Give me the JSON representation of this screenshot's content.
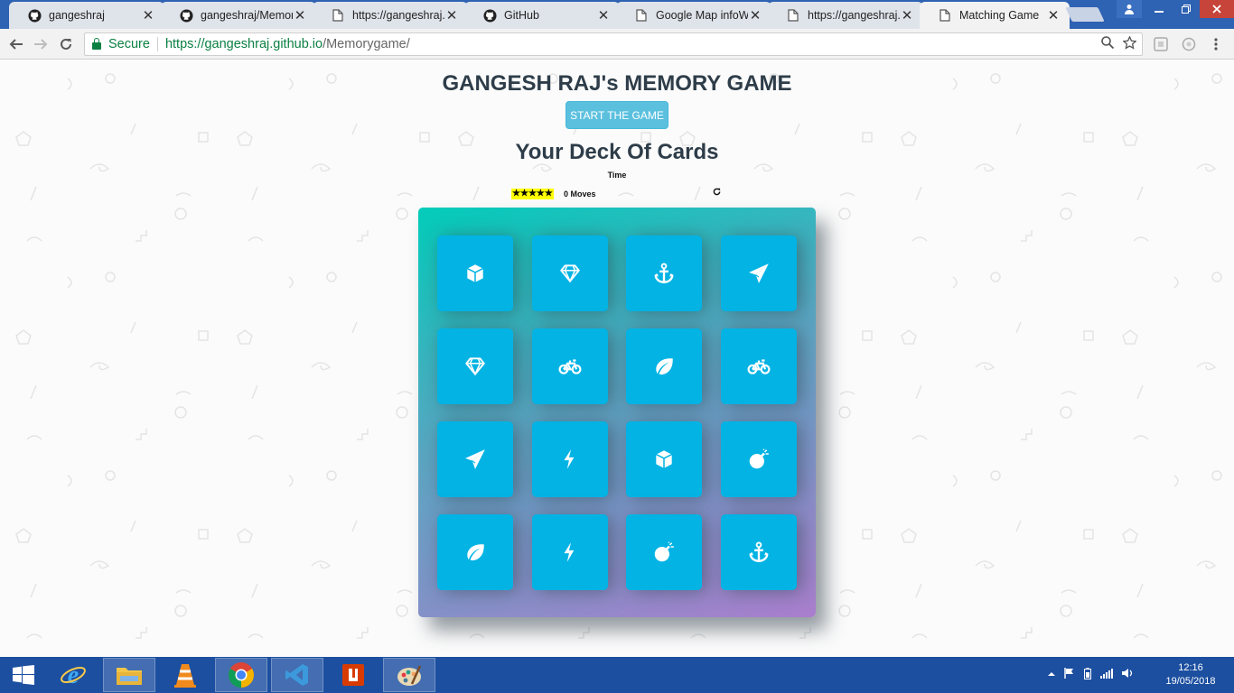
{
  "browser": {
    "tabs": [
      {
        "title": "gangeshraj",
        "icon": "github-icon"
      },
      {
        "title": "gangeshraj/Memory",
        "icon": "github-icon"
      },
      {
        "title": "https://gangeshraj.g",
        "icon": "document-icon"
      },
      {
        "title": "GitHub",
        "icon": "github-icon"
      },
      {
        "title": "Google Map infoWin",
        "icon": "document-icon"
      },
      {
        "title": "https://gangeshraj.g",
        "icon": "document-icon"
      },
      {
        "title": "Matching Game",
        "icon": "document-icon"
      }
    ],
    "security_label": "Secure",
    "url_host": "https://gangeshraj.github.io",
    "url_path": "/Memorygame/"
  },
  "game": {
    "title": "GANGESH RAJ's MEMORY GAME",
    "start_label": "START THE GAME",
    "deck_heading": "Your Deck Of Cards",
    "time_label": "Time",
    "star_count": 5,
    "moves_text": "0 Moves",
    "cards": [
      [
        "cube-icon",
        "diamond-icon",
        "anchor-icon",
        "paper-plane-icon"
      ],
      [
        "diamond-icon",
        "bicycle-icon",
        "leaf-icon",
        "bicycle-icon"
      ],
      [
        "paper-plane-icon",
        "bolt-icon",
        "cube-icon",
        "bomb-icon"
      ],
      [
        "leaf-icon",
        "bolt-icon",
        "bomb-icon",
        "anchor-icon"
      ]
    ]
  },
  "taskbar": {
    "apps": [
      "internet-explorer-icon",
      "file-explorer-icon",
      "vlc-icon",
      "chrome-icon",
      "vscode-icon",
      "office-icon",
      "paint-icon"
    ],
    "clock_time": "12:16",
    "clock_date": "19/05/2018"
  },
  "colors": {
    "card": "#02b3e4",
    "deck_start": "#02ccba",
    "deck_end": "#aa7ecd",
    "start_button": "#5bc0de",
    "heading": "#2e3d49",
    "taskbar": "#1c4fa0"
  }
}
